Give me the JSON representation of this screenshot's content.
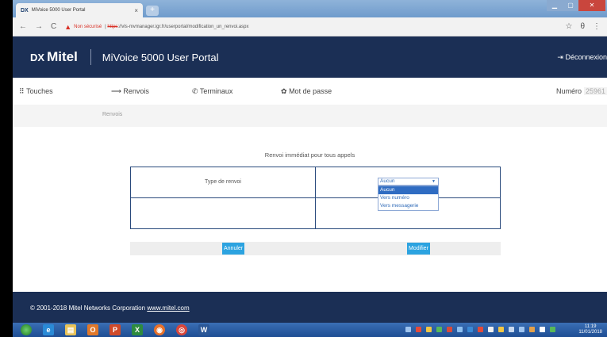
{
  "browser": {
    "tab_title": "MiVoice 5000 User Portal",
    "tab_close": "×",
    "new_tab": "+",
    "favicon": "DX",
    "not_secure": "Non sécurisé",
    "https": "https",
    "url": "://vls-mvmanager.igr.fr/userportal/modification_un_renvoi.aspx"
  },
  "header": {
    "logo_mark": "DX",
    "logo_text": "Mitel",
    "title": "MiVoice 5000 User Portal",
    "logout": "Déconnexion"
  },
  "nav": {
    "touches": "Touches",
    "renvois": "Renvois",
    "terminaux": "Terminaux",
    "mot_de_passe": "Mot de passe",
    "numero_label": "Numéro",
    "numero_value": "25961"
  },
  "breadcrumb": "Renvois",
  "content": {
    "title": "Renvoi immédiat pour tous appels",
    "type_label": "Type de renvoi",
    "selected": "Aucun",
    "options": [
      "Aucun",
      "Vers numéro",
      "Vers messagerie"
    ]
  },
  "actions": {
    "cancel": "Annuler",
    "modify": "Modifier"
  },
  "footer": {
    "copyright": "© 2001-2018 Mitel Networks Corporation",
    "link": "www.mitel.com"
  },
  "taskbar": {
    "time": "11:19",
    "date": "11/01/2018"
  },
  "colors": {
    "header_bg": "#1b2f55",
    "button_bg": "#2ca3e0",
    "grid_border": "#294a7c",
    "selected_option": "#2f6cc2"
  }
}
